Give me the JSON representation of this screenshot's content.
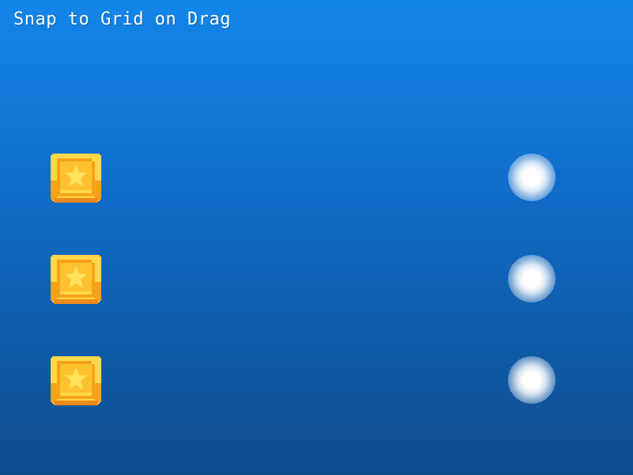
{
  "title": "Snap to Grid on Drag",
  "colors": {
    "background_top": "#1386ea",
    "background_bottom": "#0f4d8f",
    "tile_outer": "#ffd84a",
    "tile_border": "#f7a21b",
    "tile_inner": "#ffc22e",
    "tile_star": "#ffe15a",
    "tile_shadow": "#f08a1c",
    "target_glow": "#ffffff"
  },
  "draggables": [
    {
      "name": "star-tile-1",
      "icon": "star-icon"
    },
    {
      "name": "star-tile-2",
      "icon": "star-icon"
    },
    {
      "name": "star-tile-3",
      "icon": "star-icon"
    }
  ],
  "targets": [
    {
      "name": "drop-target-1",
      "icon": "glow-orb-icon"
    },
    {
      "name": "drop-target-2",
      "icon": "glow-orb-icon"
    },
    {
      "name": "drop-target-3",
      "icon": "glow-orb-icon"
    }
  ]
}
